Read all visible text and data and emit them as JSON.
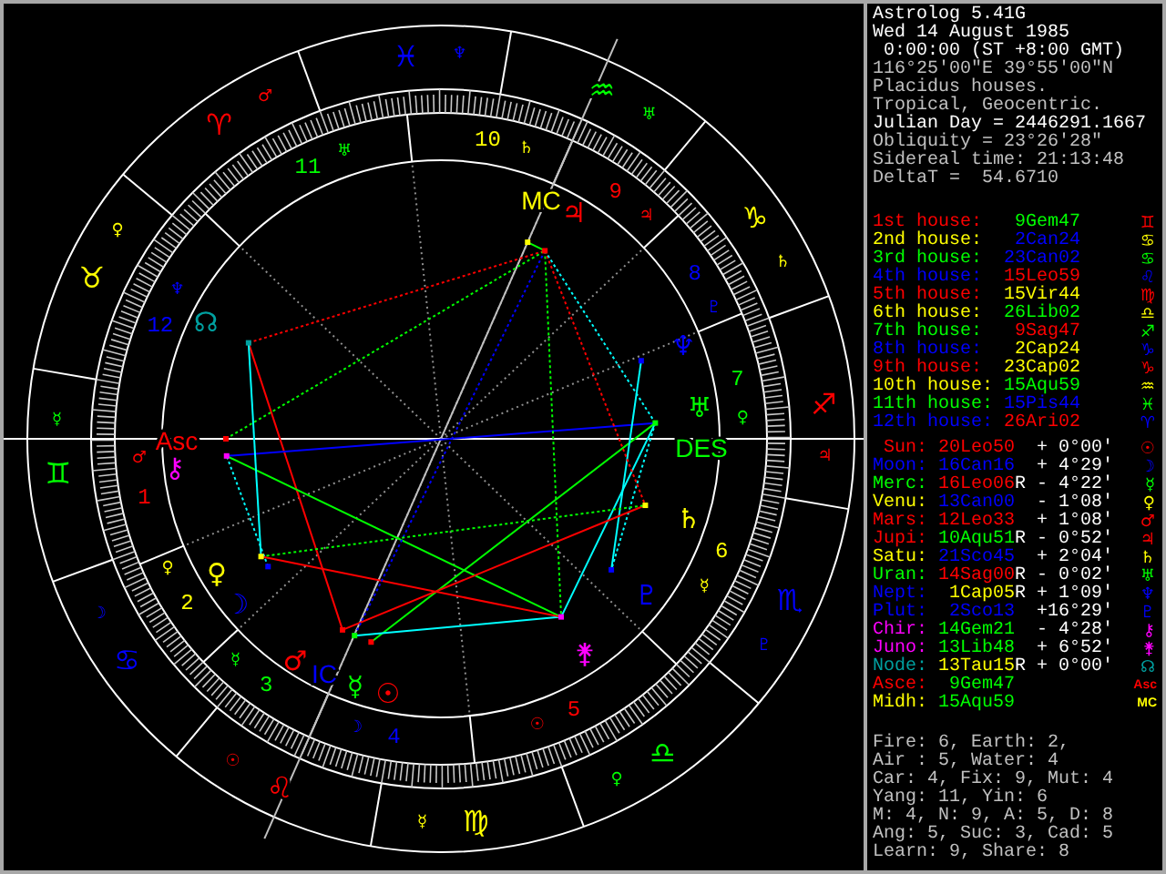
{
  "header": [
    {
      "text": "Astrolog 5.41G",
      "kind": "bright"
    },
    {
      "text": "Wed 14 August 1985",
      "kind": "bright"
    },
    {
      "text": " 0:00:00 (ST +8:00 GMT)",
      "kind": "bright"
    },
    {
      "text": "116°25'00\"E 39°55'00\"N",
      "kind": "dim"
    },
    {
      "text": "Placidus houses.",
      "kind": "dim"
    },
    {
      "text": "Tropical, Geocentric.",
      "kind": "dim"
    },
    {
      "text": "Julian Day = 2446291.1667",
      "kind": "bright"
    },
    {
      "text": "Obliquity = 23°26'28\"",
      "kind": "dim"
    },
    {
      "text": "Sidereal time: 21:13:48",
      "kind": "dim"
    },
    {
      "text": "DeltaT =  54.6710",
      "kind": "dim"
    }
  ],
  "houses": [
    {
      "label": "1st house:",
      "number": "1",
      "ruler": "♂",
      "position": {
        "text": "9Gem47",
        "color": "#00ff00"
      },
      "glyph": "♊",
      "color": "#ff0000"
    },
    {
      "label": "2nd house:",
      "number": "2",
      "ruler": "♀",
      "position": {
        "text": "2Can24",
        "color": "#0000ff"
      },
      "glyph": "♋",
      "color": "#ffff00"
    },
    {
      "label": "3rd house:",
      "number": "3",
      "ruler": "☿",
      "position": {
        "text": "23Can02",
        "color": "#0000ff"
      },
      "glyph": "♋",
      "color": "#00ff00"
    },
    {
      "label": "4th house:",
      "number": "4",
      "ruler": "☽",
      "position": {
        "text": "15Leo59",
        "color": "#ff0000"
      },
      "glyph": "♌",
      "color": "#0000ff"
    },
    {
      "label": "5th house:",
      "number": "5",
      "ruler": "☉",
      "position": {
        "text": "15Vir44",
        "color": "#ffff00"
      },
      "glyph": "♍",
      "color": "#ff0000"
    },
    {
      "label": "6th house:",
      "number": "6",
      "ruler": "☿",
      "position": {
        "text": "26Lib02",
        "color": "#00ff00"
      },
      "glyph": "♎",
      "color": "#ffff00"
    },
    {
      "label": "7th house:",
      "number": "7",
      "ruler": "♀",
      "position": {
        "text": "9Sag47",
        "color": "#ff0000"
      },
      "glyph": "♐",
      "color": "#00ff00"
    },
    {
      "label": "8th house:",
      "number": "8",
      "ruler": "♇",
      "position": {
        "text": "2Cap24",
        "color": "#ffff00"
      },
      "glyph": "♑",
      "color": "#0000ff"
    },
    {
      "label": "9th house:",
      "number": "9",
      "ruler": "♃",
      "position": {
        "text": "23Cap02",
        "color": "#ffff00"
      },
      "glyph": "♑",
      "color": "#ff0000"
    },
    {
      "label": "10th house:",
      "number": "10",
      "ruler": "♄",
      "position": {
        "text": "15Aqu59",
        "color": "#00ff00"
      },
      "glyph": "♒",
      "color": "#ffff00"
    },
    {
      "label": "11th house:",
      "number": "11",
      "ruler": "♅",
      "position": {
        "text": "15Pis44",
        "color": "#0000ff"
      },
      "glyph": "♓",
      "color": "#00ff00"
    },
    {
      "label": "12th house:",
      "number": "12",
      "ruler": "♆",
      "position": {
        "text": "26Ari02",
        "color": "#ff0000"
      },
      "glyph": "♈",
      "color": "#0000ff"
    }
  ],
  "points": [
    {
      "kind": "planet",
      "name": "Sun:",
      "position": {
        "text": "20Leo50",
        "color": "#ff0000"
      },
      "latitude": "+ 0°00'",
      "glyph": "☉",
      "wheel_glyph": "☉",
      "color": "#ff0000"
    },
    {
      "kind": "planet",
      "name": "Moon:",
      "position": {
        "text": "16Can16",
        "color": "#0000ff"
      },
      "latitude": "+ 4°29'",
      "glyph": "☽",
      "wheel_glyph": "☽",
      "color": "#0000ff"
    },
    {
      "kind": "planet",
      "name": "Merc:",
      "position": {
        "text": "16Leo06",
        "color": "#ff0000"
      },
      "flag": "R",
      "latitude": "- 4°22'",
      "glyph": "☿",
      "wheel_glyph": "☿",
      "color": "#00ff00"
    },
    {
      "kind": "planet",
      "name": "Venu:",
      "position": {
        "text": "13Can00",
        "color": "#0000ff"
      },
      "latitude": "- 1°08'",
      "glyph": "♀",
      "wheel_glyph": "♀",
      "color": "#ffff00"
    },
    {
      "kind": "planet",
      "name": "Mars:",
      "position": {
        "text": "12Leo33",
        "color": "#ff0000"
      },
      "latitude": "+ 1°08'",
      "glyph": "♂",
      "wheel_glyph": "♂",
      "color": "#ff0000"
    },
    {
      "kind": "planet",
      "name": "Jupi:",
      "position": {
        "text": "10Aqu51",
        "color": "#00ff00"
      },
      "flag": "R",
      "latitude": "- 0°52'",
      "glyph": "♃",
      "wheel_glyph": "♃",
      "color": "#ff0000"
    },
    {
      "kind": "planet",
      "name": "Satu:",
      "position": {
        "text": "21Sco45",
        "color": "#0000ff"
      },
      "latitude": "+ 2°04'",
      "glyph": "♄",
      "wheel_glyph": "♄",
      "color": "#ffff00"
    },
    {
      "kind": "planet",
      "name": "Uran:",
      "position": {
        "text": "14Sag00",
        "color": "#ff0000"
      },
      "flag": "R",
      "latitude": "- 0°02'",
      "glyph": "♅",
      "wheel_glyph": "♅",
      "color": "#00ff00"
    },
    {
      "kind": "planet",
      "name": "Nept:",
      "position": {
        "text": "1Cap05",
        "color": "#ffff00"
      },
      "flag": "R",
      "latitude": "+ 1°09'",
      "glyph": "♆",
      "wheel_glyph": "♆",
      "color": "#0000ff"
    },
    {
      "kind": "planet",
      "name": "Plut:",
      "position": {
        "text": "2Sco13",
        "color": "#0000ff"
      },
      "latitude": "+16°29'",
      "glyph": "♇",
      "wheel_glyph": "♇",
      "color": "#0000ff"
    },
    {
      "kind": "planet",
      "name": "Chir:",
      "position": {
        "text": "14Gem21",
        "color": "#00ff00"
      },
      "latitude": "- 4°28'",
      "glyph": "⚷",
      "wheel_glyph": "⚷",
      "color": "#ff00ff"
    },
    {
      "kind": "planet",
      "name": "Juno:",
      "position": {
        "text": "13Lib48",
        "color": "#00ff00"
      },
      "latitude": "+ 6°52'",
      "glyph": "⚵",
      "wheel_glyph": "⚵",
      "color": "#ff00ff"
    },
    {
      "kind": "planet",
      "name": "Node:",
      "position": {
        "text": "13Tau15",
        "color": "#ffff00"
      },
      "flag": "R",
      "latitude": "+ 0°00'",
      "glyph": "☊",
      "wheel_glyph": "☊",
      "color": "#00a0a0"
    },
    {
      "kind": "angle",
      "name": "Asce:",
      "position": {
        "text": "9Gem47",
        "color": "#00ff00"
      },
      "glyph": "Asc",
      "color": "#ff0000"
    },
    {
      "kind": "angle",
      "name": "Midh:",
      "position": {
        "text": "15Aqu59",
        "color": "#00ff00"
      },
      "glyph": "MC",
      "color": "#ffff00"
    }
  ],
  "stats": [
    "Fire: 6, Earth: 2,",
    "Air : 5, Water: 4",
    "Car: 4, Fix: 9, Mut: 4",
    "Yang: 11, Yin: 6",
    "M: 4, N: 9, A: 5, D: 8",
    "Ang: 5, Suc: 3, Cad: 5",
    "Learn: 9, Share: 8"
  ],
  "signs": [
    {
      "glyph": "♈",
      "ruler": "♂",
      "color": "#ff0000"
    },
    {
      "glyph": "♉",
      "ruler": "♀",
      "color": "#ffff00"
    },
    {
      "glyph": "♊",
      "ruler": "☿",
      "color": "#00ff00"
    },
    {
      "glyph": "♋",
      "ruler": "☽",
      "color": "#0000ff"
    },
    {
      "glyph": "♌",
      "ruler": "☉",
      "color": "#ff0000"
    },
    {
      "glyph": "♍",
      "ruler": "☿",
      "color": "#ffff00"
    },
    {
      "glyph": "♎",
      "ruler": "♀",
      "color": "#00ff00"
    },
    {
      "glyph": "♏",
      "ruler": "♇",
      "color": "#0000ff"
    },
    {
      "glyph": "♐",
      "ruler": "♃",
      "color": "#ff0000"
    },
    {
      "glyph": "♑",
      "ruler": "♄",
      "color": "#ffff00"
    },
    {
      "glyph": "♒",
      "ruler": "♅",
      "color": "#00ff00"
    },
    {
      "glyph": "♓",
      "ruler": "♆",
      "color": "#0000ff"
    }
  ],
  "angles": [
    {
      "label": "Asc",
      "color": "#ff0000"
    },
    {
      "label": "MC",
      "color": "#ffff00"
    },
    {
      "label": "DES",
      "color": "#00ff00"
    },
    {
      "label": "IC",
      "color": "#0000ff"
    }
  ]
}
